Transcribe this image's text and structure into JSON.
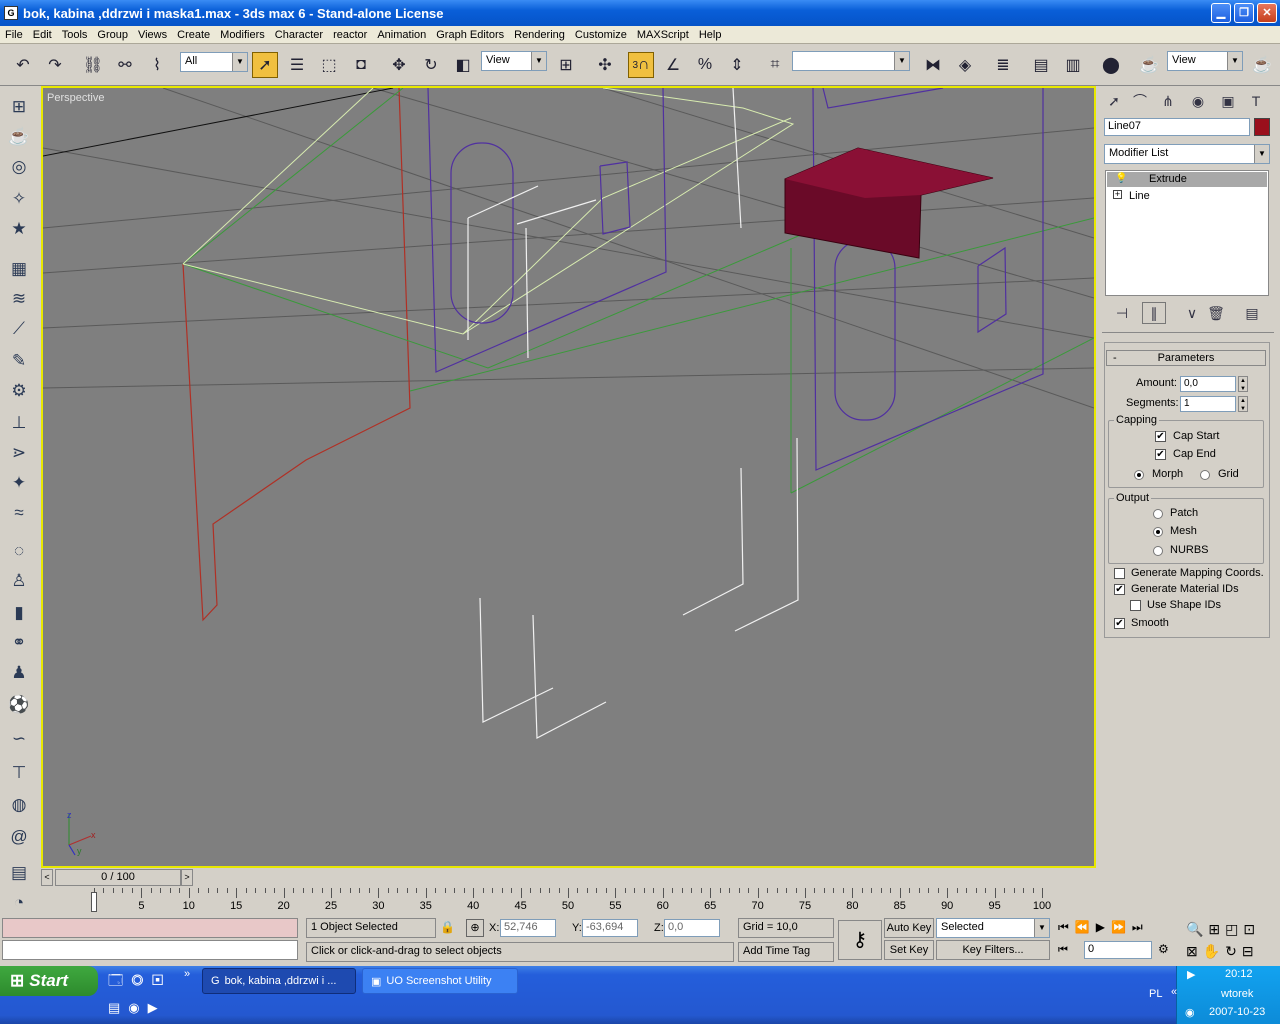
{
  "window": {
    "title": "bok, kabina ,ddrzwi i maska1.max - 3ds max 6 - Stand-alone License",
    "app_icon": "G"
  },
  "menu": [
    "File",
    "Edit",
    "Tools",
    "Group",
    "Views",
    "Create",
    "Modifiers",
    "Character",
    "reactor",
    "Animation",
    "Graph Editors",
    "Rendering",
    "Customize",
    "MAXScript",
    "Help"
  ],
  "toolbar": {
    "selection_filter": "All",
    "ref_coord": "View",
    "named_selection": "",
    "render_view": "View",
    "snap_label": "3"
  },
  "viewport": {
    "label": "Perspective",
    "axis_x": "x",
    "axis_y": "y",
    "axis_z": "z"
  },
  "command_panel": {
    "object_name": "Line07",
    "object_color": "#9a0f1c",
    "modifier_list": "Modifier List",
    "stack": [
      {
        "name": "Extrude",
        "selected": true
      },
      {
        "name": "Line",
        "selected": false
      }
    ],
    "rollout_title": "Parameters",
    "amount_label": "Amount:",
    "amount": "0,0",
    "segments_label": "Segments:",
    "segments": "1",
    "capping_title": "Capping",
    "cap_start": "Cap Start",
    "cap_end": "Cap End",
    "morph": "Morph",
    "grid": "Grid",
    "output_title": "Output",
    "patch": "Patch",
    "mesh": "Mesh",
    "nurbs": "NURBS",
    "gen_mapping": "Generate Mapping Coords.",
    "gen_material": "Generate Material IDs",
    "use_shape": "Use Shape IDs",
    "smooth": "Smooth",
    "collapse_sign": "-"
  },
  "timeline": {
    "slider": "0 / 100",
    "ticks": [
      "0",
      "5",
      "10",
      "15",
      "20",
      "25",
      "30",
      "35",
      "40",
      "45",
      "50",
      "55",
      "60",
      "65",
      "70",
      "75",
      "80",
      "85",
      "90",
      "95",
      "100"
    ]
  },
  "status": {
    "selected": "1 Object Selected",
    "prompt": "Click or click-and-drag to select objects",
    "x_label": "X:",
    "x": "52,746",
    "y_label": "Y:",
    "y": "-63,694",
    "z_label": "Z:",
    "z": "0,0",
    "grid": "Grid = 10,0",
    "add_time_tag": "Add Time Tag",
    "auto_key": "Auto Key",
    "set_key": "Set Key",
    "key_mode": "Selected",
    "key_filters": "Key Filters...",
    "frame": "0"
  },
  "taskbar": {
    "start": "Start",
    "tasks": [
      "bok, kabina ,ddrzwi i ...",
      "UO Screenshot Utility"
    ],
    "lang": "PL",
    "time": "20:12",
    "day": "wtorek",
    "date": "2007-10-23",
    "more": "»"
  }
}
